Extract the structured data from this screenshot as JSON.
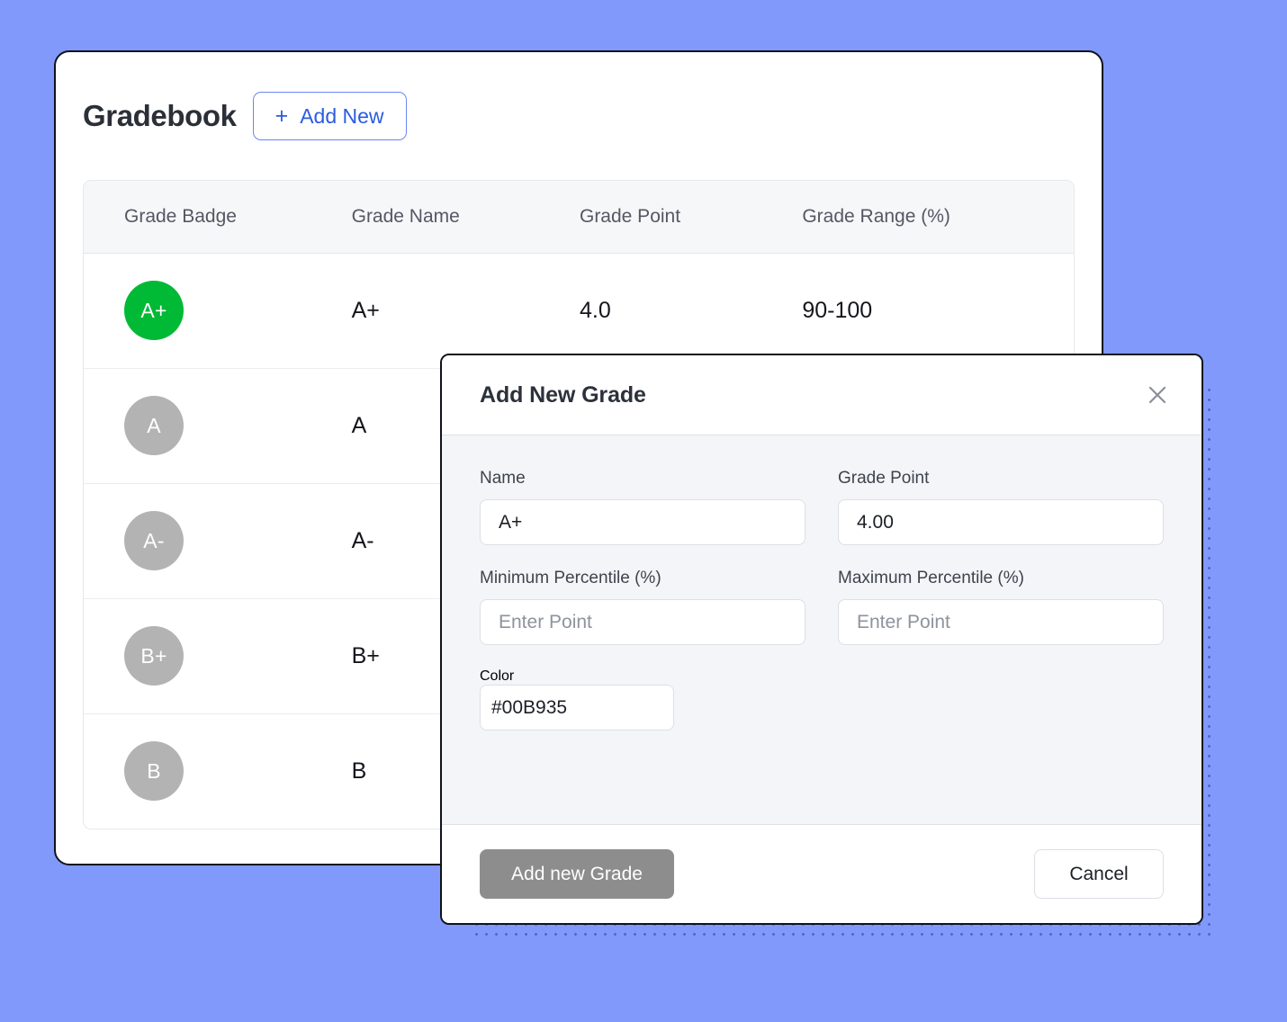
{
  "theme": {
    "page_background": "#8099FA",
    "accent_blue": "#2B5CE0",
    "badge_green": "#00B935",
    "badge_gray": "#B3B3B3",
    "primary_button": "#8D8D8D"
  },
  "gradebook": {
    "title": "Gradebook",
    "add_new_label": "Add New",
    "add_new_plus": "+",
    "table": {
      "columns": [
        "Grade Badge",
        "Grade Name",
        "Grade Point",
        "Grade Range (%)"
      ],
      "rows": [
        {
          "badge": "A+",
          "badge_color": "#00B935",
          "name": "A+",
          "point": "4.0",
          "range": "90-100"
        },
        {
          "badge": "A",
          "badge_color": "#B3B3B3",
          "name": "A",
          "point": "",
          "range": ""
        },
        {
          "badge": "A-",
          "badge_color": "#B3B3B3",
          "name": "A-",
          "point": "",
          "range": ""
        },
        {
          "badge": "B+",
          "badge_color": "#B3B3B3",
          "name": "B+",
          "point": "",
          "range": ""
        },
        {
          "badge": "B",
          "badge_color": "#B3B3B3",
          "name": "B",
          "point": "",
          "range": ""
        }
      ]
    }
  },
  "modal": {
    "title": "Add New Grade",
    "close_icon": "close-icon",
    "fields": {
      "name": {
        "label": "Name",
        "value": "A+",
        "placeholder": ""
      },
      "grade_point": {
        "label": "Grade Point",
        "value": "4.00",
        "placeholder": ""
      },
      "min_percentile": {
        "label": "Minimum Percentile (%)",
        "value": "",
        "placeholder": "Enter Point"
      },
      "max_percentile": {
        "label": "Maximum Percentile (%)",
        "value": "",
        "placeholder": "Enter Point"
      },
      "color": {
        "label": "Color",
        "value": "#00B935",
        "swatch": "#00B935"
      }
    },
    "footer": {
      "submit_label": "Add new Grade",
      "cancel_label": "Cancel"
    }
  }
}
